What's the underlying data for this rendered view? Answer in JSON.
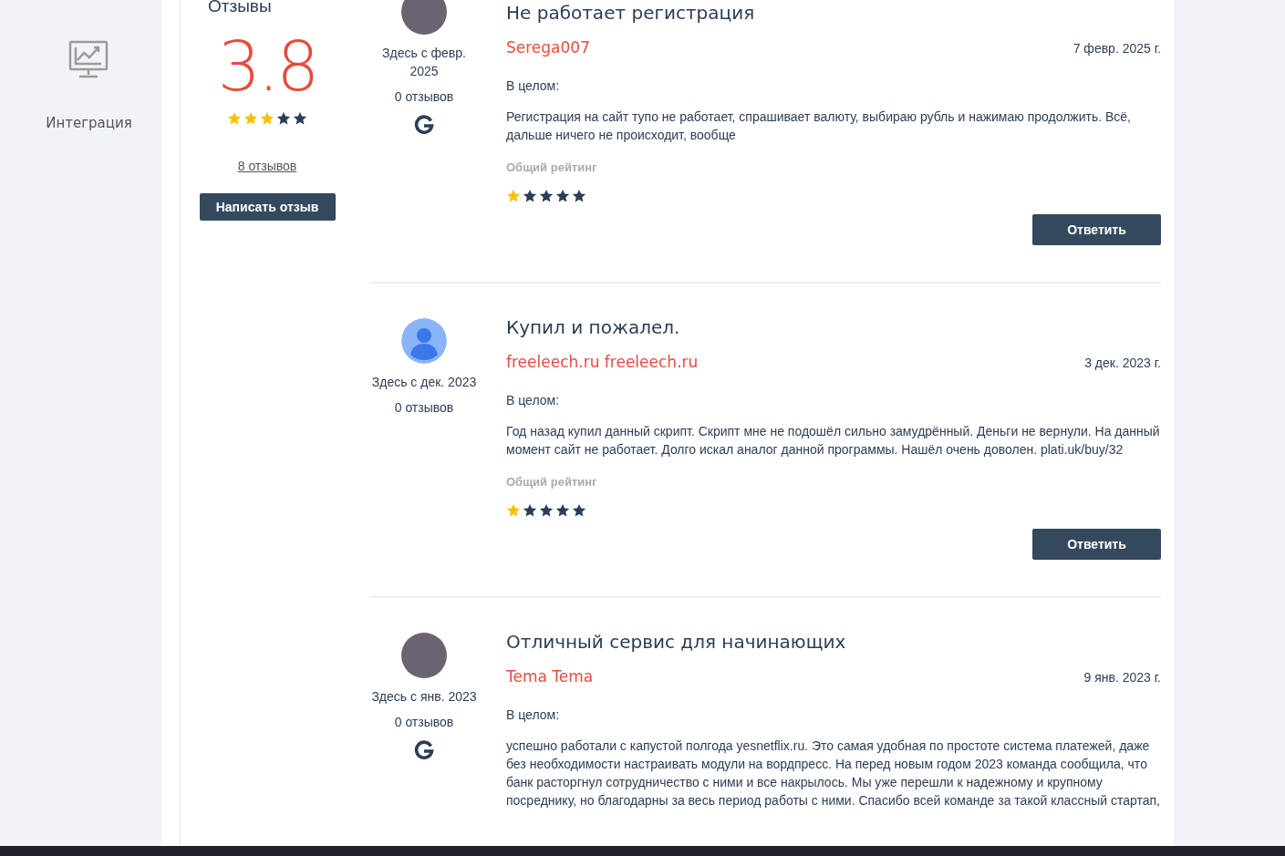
{
  "sidebar": {
    "items": [
      {
        "label": "Интеграция"
      }
    ]
  },
  "summary": {
    "title": "Отзывы",
    "score": "3.8",
    "stars": 3,
    "count_link": "8 отзывов",
    "write_button": "Написать отзыв"
  },
  "reviews": [
    {
      "kind": "photo",
      "since": "Здесь с февр. 2025",
      "reviews_count": "0 отзывов",
      "source_icon": true,
      "title": "Не работает регистрация",
      "author": "Serega007",
      "date": "7 февр. 2025 г.",
      "overall_label": "В целом:",
      "text": "Регистрация на сайт тупо не работает, спрашивает валюту, выбираю рубль и нажимаю продолжить. Всё, дальше ничего не происходит, вообще",
      "rating_label": "Общий рейтинг",
      "stars": 1,
      "reply": "Ответить"
    },
    {
      "kind": "silhouette",
      "since": "Здесь с дек. 2023",
      "reviews_count": "0 отзывов",
      "source_icon": false,
      "title": "Купил и пожалел.",
      "author": "freeleech.ru freeleech.ru",
      "date": "3 дек. 2023 г.",
      "overall_label": "В целом:",
      "text": "Год назад купил данный скрипт. Скрипт мне не подошёл сильно замудрённый. Деньги не вернули. На данный момент сайт не работает. Долго искал аналог данной программы. Нашёл очень доволен. plati.uk/buy/32",
      "rating_label": "Общий рейтинг",
      "stars": 1,
      "reply": "Ответить"
    },
    {
      "kind": "photo",
      "since": "Здесь с янв. 2023",
      "reviews_count": "0 отзывов",
      "source_icon": true,
      "title": "Отличный сервис для начинающих",
      "author": "Tema Tema",
      "date": "9 янв. 2023 г.",
      "overall_label": "В целом:",
      "text": "успешно работали с капустой полгода yesnetflix.ru. Это самая удобная по простоте система платежей, даже без необходимости настраивать модули на вордпресс. На перед новым годом 2023 команда сообщила, что банк расторгнул сотрудничество с ними и все накрылось. Мы уже перешли к надежному и крупному посреднику, но благодарны за весь период работы с ними. Спасибо всей команде за такой классный стартап,"
    }
  ]
}
